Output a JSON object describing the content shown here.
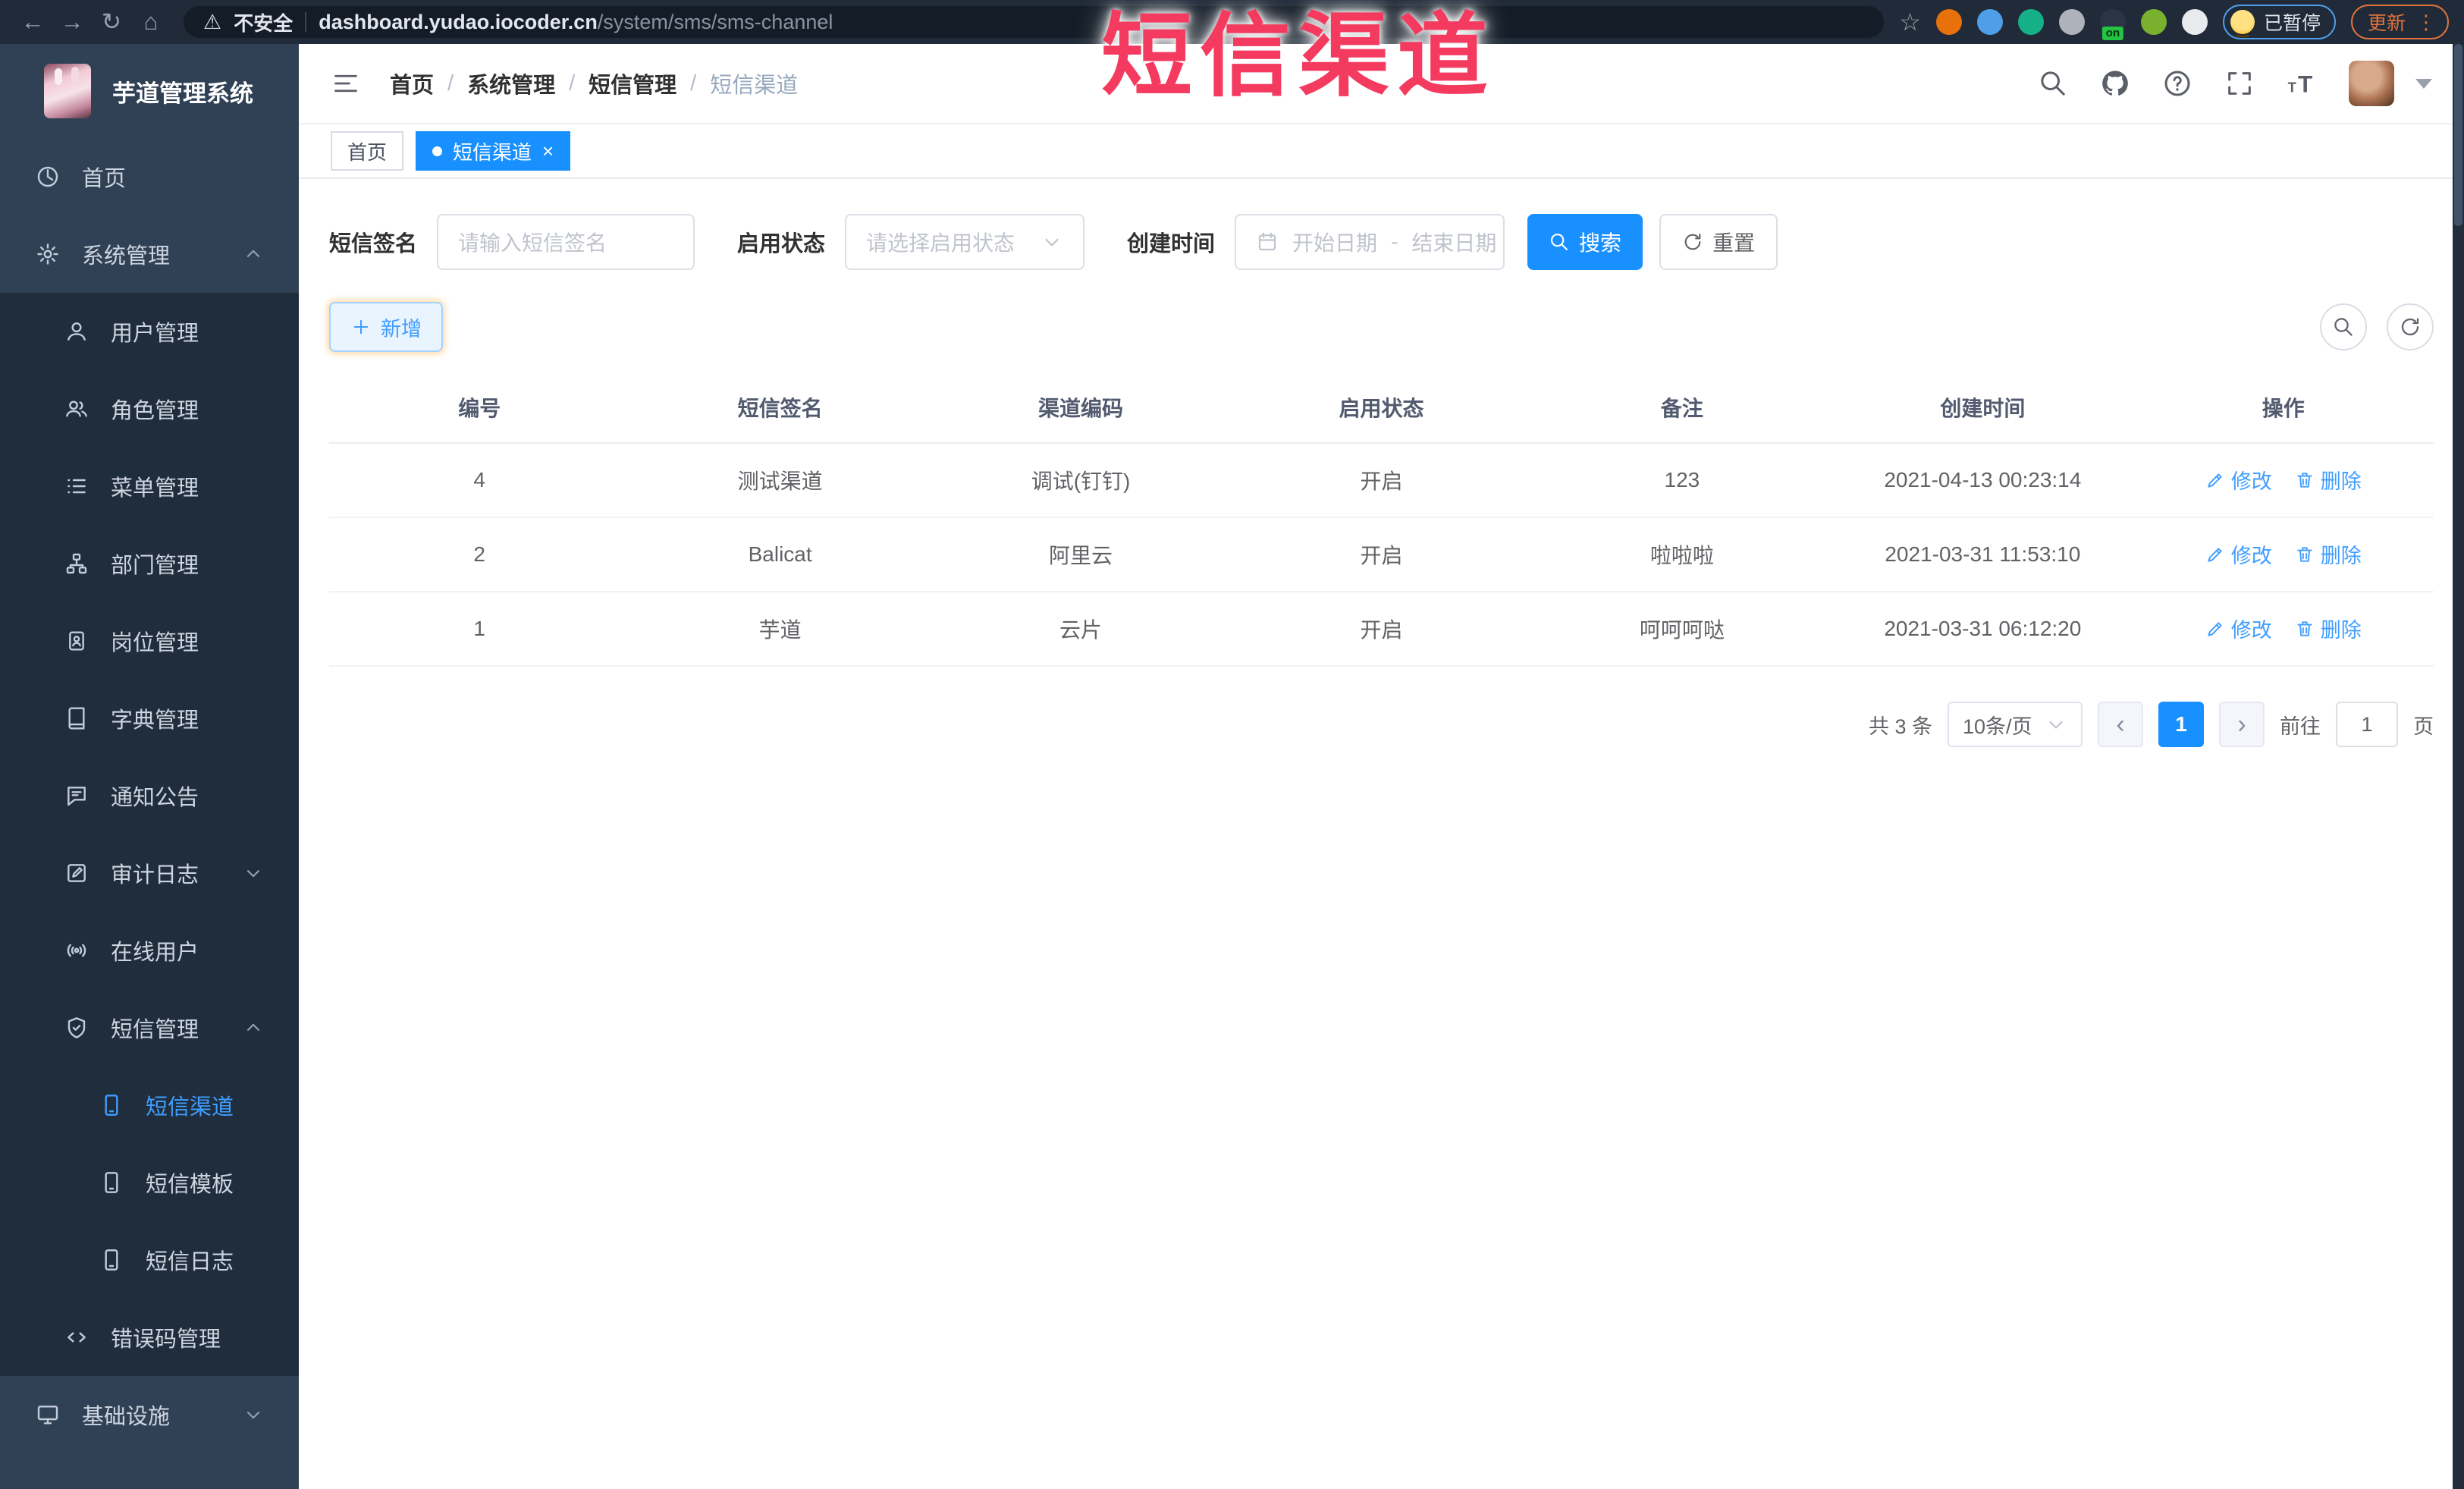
{
  "colors": {
    "primary": "#1890ff",
    "link": "#409eff",
    "overlay_red": "#f43b5f",
    "sidebar_bg": "#304156",
    "submenu_bg": "#1f2d3d"
  },
  "overlay": {
    "text": "短信渠道"
  },
  "browser": {
    "nav_icons": [
      "back",
      "forward",
      "reload",
      "home"
    ],
    "security_label": "不安全",
    "url_host": "dashboard.yudao.iocoder.cn",
    "url_path": "/system/sms/sms-channel",
    "extensions": [
      {
        "name": "orange-extension",
        "color": "#e8710a"
      },
      {
        "name": "location-extension",
        "color": "#4f9ee8"
      },
      {
        "name": "check-extension",
        "color": "#15b087"
      },
      {
        "name": "grid-extension",
        "color": "#aeb3bb"
      },
      {
        "name": "dark-extension",
        "color": "#2b3442",
        "badge": "on"
      },
      {
        "name": "leaf-extension",
        "color": "#79b12e"
      },
      {
        "name": "puzzle-extension",
        "color": "#e8eaed"
      }
    ],
    "paused_badge": "已暂停",
    "update_button": "更新"
  },
  "sidebar": {
    "app_title": "芋道管理系统",
    "items": [
      {
        "key": "home",
        "label": "首页",
        "level": 1,
        "icon": "dashboard"
      },
      {
        "key": "system-mgmt",
        "label": "系统管理",
        "level": 1,
        "icon": "gear",
        "chevron": "up"
      },
      {
        "key": "user-mgmt",
        "label": "用户管理",
        "level": 2,
        "icon": "user"
      },
      {
        "key": "role-mgmt",
        "label": "角色管理",
        "level": 2,
        "icon": "users"
      },
      {
        "key": "menu-mgmt",
        "label": "菜单管理",
        "level": 2,
        "icon": "menu-list"
      },
      {
        "key": "dept-mgmt",
        "label": "部门管理",
        "level": 2,
        "icon": "org-tree"
      },
      {
        "key": "post-mgmt",
        "label": "岗位管理",
        "level": 2,
        "icon": "badge"
      },
      {
        "key": "dict-mgmt",
        "label": "字典管理",
        "level": 2,
        "icon": "dictionary"
      },
      {
        "key": "notice",
        "label": "通知公告",
        "level": 2,
        "icon": "announcement"
      },
      {
        "key": "audit-log",
        "label": "审计日志",
        "level": 2,
        "icon": "audit-log",
        "chevron": "down"
      },
      {
        "key": "online-user",
        "label": "在线用户",
        "level": 2,
        "icon": "online-user"
      },
      {
        "key": "sms-mgmt",
        "label": "短信管理",
        "level": 2,
        "icon": "sms-shield",
        "chevron": "up"
      },
      {
        "key": "sms-channel",
        "label": "短信渠道",
        "level": 3,
        "icon": "phone",
        "active": true
      },
      {
        "key": "sms-template",
        "label": "短信模板",
        "level": 3,
        "icon": "phone"
      },
      {
        "key": "sms-log",
        "label": "短信日志",
        "level": 3,
        "icon": "phone"
      },
      {
        "key": "error-code",
        "label": "错误码管理",
        "level": 2,
        "icon": "code"
      },
      {
        "key": "infrastructure",
        "label": "基础设施",
        "level": 1,
        "icon": "monitor",
        "chevron": "down"
      }
    ]
  },
  "header": {
    "breadcrumb": [
      "首页",
      "系统管理",
      "短信管理",
      "短信渠道"
    ],
    "breadcrumb_separator": "/",
    "icons": [
      "search",
      "github",
      "help",
      "fullscreen",
      "font-size"
    ]
  },
  "tags": [
    {
      "key": "home",
      "label": "首页",
      "active": false,
      "closable": false
    },
    {
      "key": "sms-channel",
      "label": "短信渠道",
      "active": true,
      "closable": true
    }
  ],
  "filters": {
    "sign_label": "短信签名",
    "sign_placeholder": "请输入短信签名",
    "status_label": "启用状态",
    "status_placeholder": "请选择启用状态",
    "time_label": "创建时间",
    "date_start_placeholder": "开始日期",
    "date_separator": "-",
    "date_end_placeholder": "结束日期",
    "search_button": "搜索",
    "reset_button": "重置"
  },
  "toolbar": {
    "add_button": "新增"
  },
  "table": {
    "headers": [
      "编号",
      "短信签名",
      "渠道编码",
      "启用状态",
      "备注",
      "创建时间",
      "操作"
    ],
    "rows": [
      {
        "id": "4",
        "sign": "测试渠道",
        "code": "调试(钉钉)",
        "status": "开启",
        "remark": "123",
        "created": "2021-04-13 00:23:14"
      },
      {
        "id": "2",
        "sign": "Balicat",
        "code": "阿里云",
        "status": "开启",
        "remark": "啦啦啦",
        "created": "2021-03-31 11:53:10"
      },
      {
        "id": "1",
        "sign": "芋道",
        "code": "云片",
        "status": "开启",
        "remark": "呵呵呵哒",
        "created": "2021-03-31 06:12:20"
      }
    ],
    "actions": {
      "edit": "修改",
      "delete": "删除"
    }
  },
  "pagination": {
    "total_label": "共 3 条",
    "page_size": "10条/页",
    "prev": "‹",
    "active_page": "1",
    "next": "›",
    "goto_label": "前往",
    "goto_value": "1",
    "goto_suffix": "页"
  }
}
